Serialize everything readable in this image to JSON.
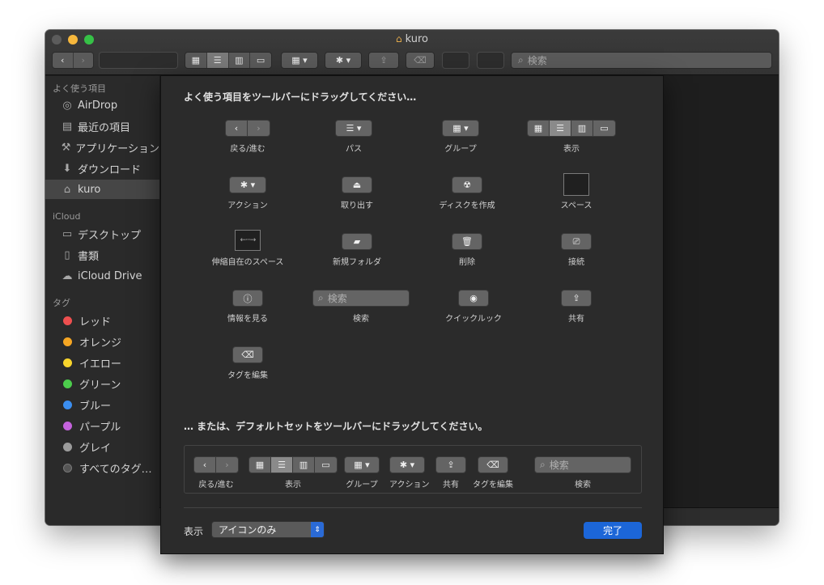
{
  "window": {
    "title": "kuro",
    "search_placeholder": "検索"
  },
  "sidebar": {
    "favorites_heading": "よく使う項目",
    "favorites": [
      {
        "label": "AirDrop",
        "icon": "airdrop-icon"
      },
      {
        "label": "最近の項目",
        "icon": "recents-icon"
      },
      {
        "label": "アプリケーション",
        "icon": "applications-icon"
      },
      {
        "label": "ダウンロード",
        "icon": "downloads-icon"
      },
      {
        "label": "kuro",
        "icon": "home-icon"
      }
    ],
    "icloud_heading": "iCloud",
    "icloud": [
      {
        "label": "デスクトップ",
        "icon": "desktop-icon"
      },
      {
        "label": "書類",
        "icon": "documents-icon"
      },
      {
        "label": "iCloud Drive",
        "icon": "cloud-icon"
      }
    ],
    "tags_heading": "タグ",
    "tags": [
      {
        "label": "レッド",
        "color": "#ee4f4f"
      },
      {
        "label": "オレンジ",
        "color": "#f5a623"
      },
      {
        "label": "イエロー",
        "color": "#f8d42c"
      },
      {
        "label": "グリーン",
        "color": "#4ccd4c"
      },
      {
        "label": "ブルー",
        "color": "#3b8ef0"
      },
      {
        "label": "パープル",
        "color": "#c462dc"
      },
      {
        "label": "グレイ",
        "color": "#9b9b9b"
      },
      {
        "label": "すべてのタグ…",
        "color": "#555555"
      }
    ]
  },
  "sheet": {
    "title": "よく使う項目をツールバーにドラッグしてください…",
    "items": {
      "back_forward": "戻る/進む",
      "path": "パス",
      "group": "グループ",
      "view": "表示",
      "action": "アクション",
      "eject": "取り出す",
      "burn": "ディスクを作成",
      "space": "スペース",
      "flex_space": "伸縮自在のスペース",
      "new_folder": "新規フォルダ",
      "delete": "削除",
      "connect": "接続",
      "get_info": "情報を見る",
      "search": "検索",
      "search_placeholder": "検索",
      "quick_look": "クイックルック",
      "share": "共有",
      "edit_tags": "タグを編集"
    },
    "default_set_title": "… または、デフォルトセットをツールバーにドラッグしてください。",
    "default_set": {
      "back_forward": "戻る/進む",
      "view": "表示",
      "group": "グループ",
      "action": "アクション",
      "share": "共有",
      "edit_tags": "タグを編集",
      "search": "検索",
      "search_placeholder": "検索"
    },
    "show_label": "表示",
    "show_value": "アイコンのみ",
    "done": "完了"
  }
}
